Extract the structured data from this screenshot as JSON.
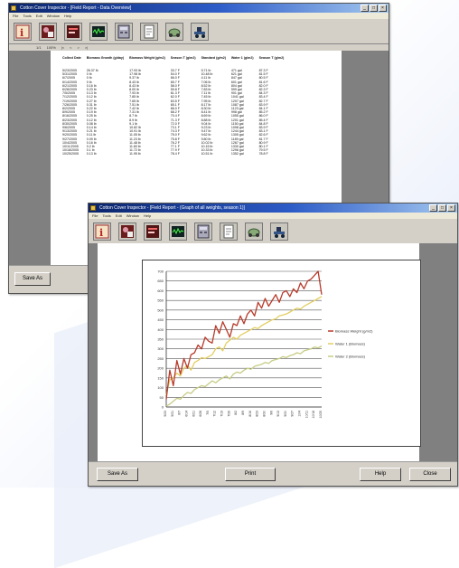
{
  "window1": {
    "title": "Cotton Cover Inspector - [Field Report - Data Overview]",
    "menu": [
      "File",
      "Tools",
      "Edit",
      "Window",
      "Help"
    ],
    "toolbar_icons": [
      "crop-info-icon",
      "field-map-icon",
      "report-icon",
      "waveform-icon",
      "calculator-icon",
      "notepad-icon",
      "sprayer-icon",
      "tractor-icon"
    ],
    "nav": [
      "1/1",
      "100%",
      "|<",
      "<",
      ">",
      ">|"
    ],
    "table": {
      "columns": [
        "Collect Date",
        "Biomass Growth (g/day)",
        "Biomass Weight (g/m2)",
        "Season T (g/m2)",
        "Standard (g/m2)",
        "Water 1 (g/m2)",
        "Season T (g/m2)"
      ],
      "rows": [
        [
          "5/23/2005",
          "26.37 lb",
          "17.93 lb",
          "33.7 F",
          "5.71 lb",
          "471 gal",
          "87.3 F"
        ],
        [
          "5/31/2005",
          "0 lb",
          "17.98 lb",
          "54.0 F",
          "10.48 lb",
          "621 gal",
          "81.5 F"
        ],
        [
          "6/7/2005",
          "0 lb",
          "9.37 lb",
          "66.0 F",
          "4.11 lb",
          "847 gal",
          "80.5 F"
        ],
        [
          "6/14/2005",
          "0 lb",
          "8.43 lb",
          "65.7 F",
          "7.06 lb",
          "601 gal",
          "81.6 F"
        ],
        [
          "6/21/2005",
          "0.16 lb",
          "8.43 lb",
          "58.0 F",
          "8.52 lb",
          "804 gal",
          "82.0 F"
        ],
        [
          "6/28/2005",
          "0.23 lb",
          "8.00 lb",
          "59.8 F",
          "7.83 lb",
          "599 gal",
          "82.3 F"
        ],
        [
          "7/5/2005",
          "0.13 lb",
          "7.93 lb",
          "61.3 F",
          "7.11 lb",
          "901 gal",
          "84.3 F"
        ],
        [
          "7/12/2005",
          "0.12 lb",
          "7.85 lb",
          "62.0 F",
          "7.45 lb",
          "1041 gal",
          "83.4 F"
        ],
        [
          "7/19/2005",
          "0.27 lb",
          "7.65 lb",
          "63.5 F",
          "7.95 lb",
          "1207 gal",
          "82.7 F"
        ],
        [
          "7/26/2005",
          "0.31 lb",
          "7.51 lb",
          "65.1 F",
          "8.17 lb",
          "1087 gal",
          "83.9 F"
        ],
        [
          "8/2/2005",
          "0.22 lb",
          "7.42 lb",
          "66.0 F",
          "8.30 lb",
          "1123 gal",
          "84.1 F"
        ],
        [
          "8/9/2005",
          "0.19 lb",
          "7.31 lb",
          "68.2 F",
          "8.41 lb",
          "998 gal",
          "85.2 F"
        ],
        [
          "8/16/2005",
          "0.25 lb",
          "8.7 lb",
          "70.4 F",
          "8.69 lb",
          "1055 gal",
          "86.0 F"
        ],
        [
          "8/23/2005",
          "0.12 lb",
          "8.9 lb",
          "71.3 F",
          "8.88 lb",
          "1201 gal",
          "85.4 F"
        ],
        [
          "8/30/2005",
          "0.08 lb",
          "9.1 lb",
          "72.0 F",
          "9.04 lb",
          "1150 gal",
          "84.8 F"
        ],
        [
          "9/6/2005",
          "0.14 lb",
          "10.82 lb",
          "73.1 F",
          "9.23 lb",
          "1098 gal",
          "83.9 F"
        ],
        [
          "9/13/2005",
          "0.21 lb",
          "10.91 lb",
          "74.3 F",
          "9.47 lb",
          "1244 gal",
          "83.1 F"
        ],
        [
          "9/20/2005",
          "0.11 lb",
          "11.05 lb",
          "75.0 F",
          "9.62 lb",
          "1305 gal",
          "82.6 F"
        ],
        [
          "9/27/2005",
          "0.09 lb",
          "11.23 lb",
          "75.8 F",
          "9.80 lb",
          "1189 gal",
          "81.7 F"
        ],
        [
          "10/4/2005",
          "0.16 lb",
          "11.48 lb",
          "76.2 F",
          "10.02 lb",
          "1267 gal",
          "80.9 F"
        ],
        [
          "10/11/2005",
          "0.2 lb",
          "11.60 lb",
          "77.1 F",
          "10.15 lb",
          "1330 gal",
          "80.1 F"
        ],
        [
          "10/18/2005",
          "0.1 lb",
          "11.72 lb",
          "77.9 F",
          "10.33 lb",
          "1296 gal",
          "79.5 F"
        ],
        [
          "10/25/2005",
          "0.13 lb",
          "11.95 lb",
          "78.4 F",
          "10.51 lb",
          "1352 gal",
          "78.8 F"
        ]
      ]
    },
    "save_as": "Save As"
  },
  "window2": {
    "title": "Cotton Cover Inspector - [Field Report - (Graph of all weights, season 1)]",
    "menu": [
      "File",
      "Tools",
      "Edit",
      "Window",
      "Help"
    ],
    "toolbar_icons": [
      "crop-info-icon",
      "field-map-icon",
      "report-icon",
      "waveform-icon",
      "calculator-icon",
      "notepad-icon",
      "sprayer-icon",
      "tractor-icon"
    ],
    "save_as": "Save As",
    "print": "Print",
    "help": "Help",
    "close": "Close"
  },
  "chart_data": {
    "type": "line",
    "x_count": 45,
    "ylim": [
      0,
      700
    ],
    "grid": true,
    "legend": "right",
    "y_ticks": [
      "0",
      "50",
      "100",
      "150",
      "200",
      "250",
      "300",
      "350",
      "400",
      "450",
      "500",
      "550",
      "600",
      "650",
      "700"
    ],
    "x_labels": [
      "5/23",
      "5/31",
      "6/7",
      "6/14",
      "6/21",
      "6/28",
      "7/5",
      "7/12",
      "7/19",
      "7/26",
      "8/2",
      "8/9",
      "8/16",
      "8/23",
      "8/30",
      "9/6",
      "9/13",
      "9/20",
      "9/27",
      "10/4",
      "10/11",
      "10/18",
      "10/25"
    ],
    "series": [
      {
        "name": "Biomass Weight (g/m2)",
        "color": "#b83a2a",
        "values": [
          40,
          190,
          110,
          240,
          170,
          250,
          200,
          270,
          280,
          320,
          300,
          360,
          340,
          330,
          420,
          380,
          440,
          400,
          360,
          430,
          420,
          470,
          430,
          480,
          500,
          470,
          540,
          510,
          560,
          520,
          550,
          580,
          540,
          590,
          600,
          570,
          610,
          590,
          640,
          610,
          650,
          660,
          680,
          700,
          580
        ]
      },
      {
        "name": "Water 1 (Biomass)",
        "color": "#e3cf62",
        "values": [
          60,
          140,
          150,
          175,
          160,
          200,
          215,
          190,
          230,
          240,
          255,
          250,
          260,
          270,
          300,
          310,
          290,
          330,
          345,
          360,
          350,
          370,
          380,
          390,
          400,
          410,
          405,
          420,
          430,
          440,
          450,
          455,
          470,
          475,
          480,
          490,
          500,
          510,
          505,
          520,
          530,
          540,
          550,
          560,
          570
        ]
      },
      {
        "name": "Water 2 (Biomass)",
        "color": "#c7cc84",
        "values": [
          5,
          15,
          30,
          45,
          40,
          60,
          75,
          70,
          90,
          100,
          110,
          105,
          120,
          135,
          125,
          140,
          150,
          160,
          145,
          170,
          180,
          175,
          190,
          200,
          195,
          210,
          215,
          220,
          230,
          225,
          240,
          245,
          250,
          260,
          255,
          265,
          270,
          280,
          275,
          290,
          295,
          300,
          310,
          305,
          315
        ]
      }
    ]
  }
}
